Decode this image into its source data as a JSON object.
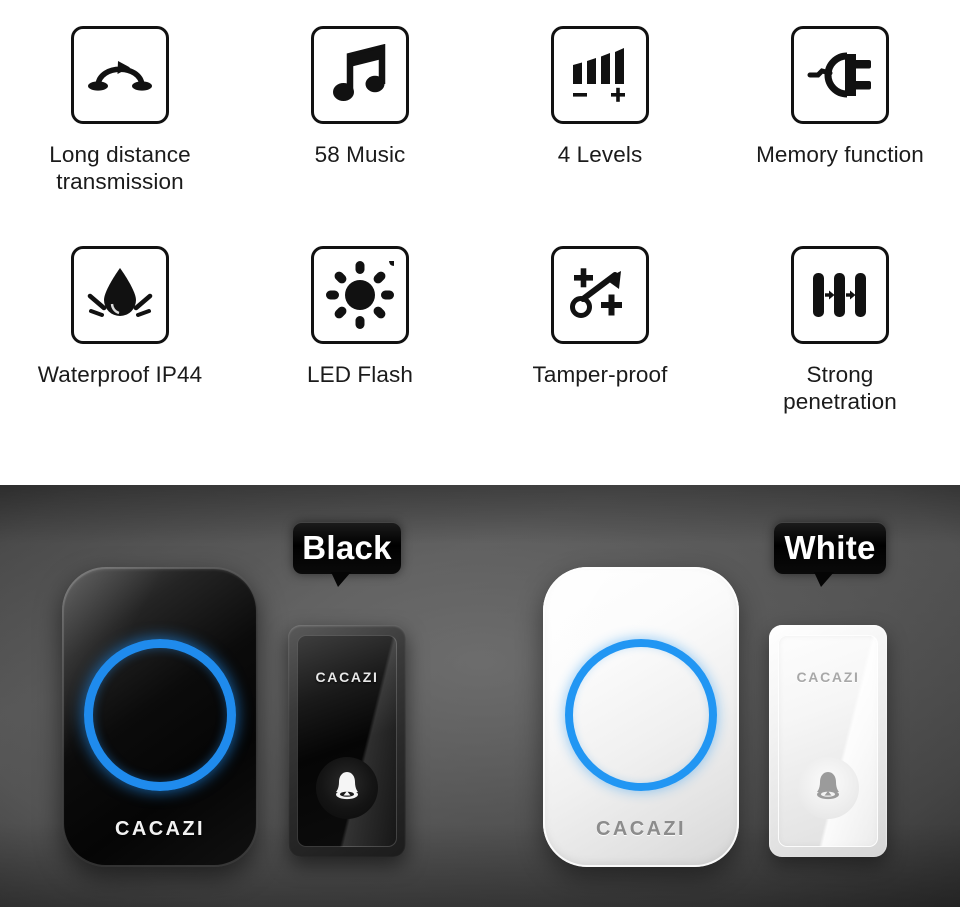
{
  "features": {
    "rows": [
      [
        {
          "icon": "long-distance-transmission-icon",
          "label": "Long distance\ntransmission"
        },
        {
          "icon": "music-note-icon",
          "label": "58 Music"
        },
        {
          "icon": "volume-levels-icon",
          "label": "4 Levels"
        },
        {
          "icon": "power-plug-icon",
          "label": "Memory function"
        }
      ],
      [
        {
          "icon": "water-drop-splash-icon",
          "label": "Waterproof IP44"
        },
        {
          "icon": "sun-brightness-icon",
          "label": "LED Flash"
        },
        {
          "icon": "tamper-proof-arrow-icon",
          "label": "Tamper-proof"
        },
        {
          "icon": "signal-penetration-icon",
          "label": "Strong\npenetration"
        }
      ]
    ],
    "volume_minus": "−",
    "volume_plus": "+"
  },
  "showcase": {
    "black": {
      "badge": "Black",
      "receiver_brand": "CACAZI",
      "transmitter_brand": "CACAZI",
      "led_ring_color": "#1f8bed"
    },
    "white": {
      "badge": "White",
      "receiver_brand": "CACAZI",
      "transmitter_brand": "CACAZI",
      "led_ring_color": "#2196f3"
    }
  },
  "colors": {
    "panel_background": "#ffffff",
    "icon_outline": "#111111",
    "label_text": "#1b1b1b",
    "photo_background": "#565656",
    "badge_background": "#000000",
    "badge_text": "#ffffff"
  }
}
